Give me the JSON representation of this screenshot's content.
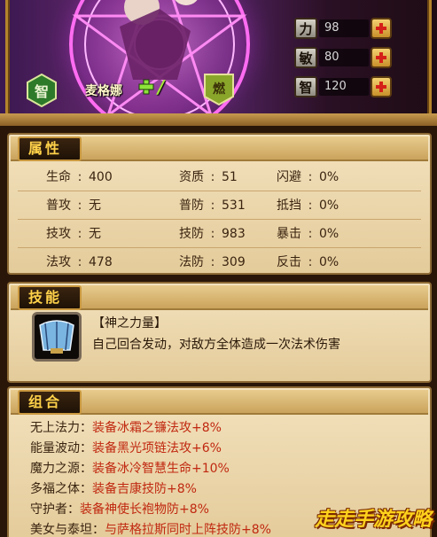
{
  "hero": {
    "name": "麦格娜",
    "star_mark": "/",
    "badge_left": "智",
    "badge_right": "燃",
    "stats": [
      {
        "label": "力",
        "value": "98"
      },
      {
        "label": "敏",
        "value": "80"
      },
      {
        "label": "智",
        "value": "120"
      }
    ]
  },
  "attributes": {
    "title": "属性",
    "rows": [
      [
        {
          "k": "生命",
          "v": "400"
        },
        {
          "k": "资质",
          "v": "51"
        },
        {
          "k": "闪避",
          "v": "0%"
        }
      ],
      [
        {
          "k": "普攻",
          "v": "无"
        },
        {
          "k": "普防",
          "v": "531"
        },
        {
          "k": "抵挡",
          "v": "0%"
        }
      ],
      [
        {
          "k": "技攻",
          "v": "无"
        },
        {
          "k": "技防",
          "v": "983"
        },
        {
          "k": "暴击",
          "v": "0%"
        }
      ],
      [
        {
          "k": "法攻",
          "v": "478"
        },
        {
          "k": "法防",
          "v": "309"
        },
        {
          "k": "反击",
          "v": "0%"
        }
      ]
    ]
  },
  "skill": {
    "title": "技能",
    "name": "【神之力量】",
    "description": "自己回合发动，对敌方全体造成一次法术伤害"
  },
  "combo": {
    "title": "组合",
    "items": [
      {
        "name": "无上法力：",
        "desc": "装备冰霜之镰法攻+8%"
      },
      {
        "name": "能量波动：",
        "desc": "装备黑光项链法攻+6%"
      },
      {
        "name": "魔力之源：",
        "desc": "装备冰冷智慧生命+10%"
      },
      {
        "name": "多福之体：",
        "desc": "装备吉康技防+8%"
      },
      {
        "name": "守护者：",
        "desc": "装备神使长袍物防+8%"
      },
      {
        "name": "美女与泰坦：",
        "desc": "与萨格拉斯同时上阵技防+8%"
      }
    ]
  },
  "watermark": "走走手游攻略",
  "colors": {
    "panel_bg": "#f0dcb4",
    "title_text": "#ffd24a",
    "combo_desc": "#c02810"
  }
}
